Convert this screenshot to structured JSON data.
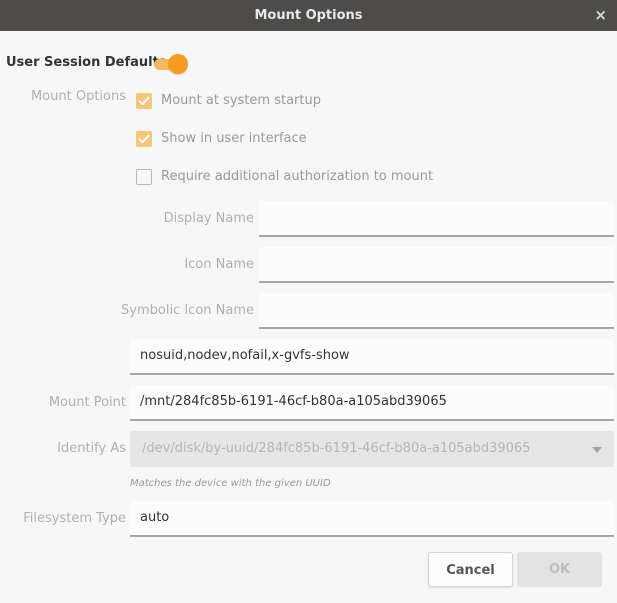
{
  "window": {
    "title": "Mount Options",
    "close_glyph": "×"
  },
  "section": {
    "title": "User Session Defaults",
    "toggle_on": true
  },
  "labels": {
    "mount_options": "Mount Options",
    "display_name": "Display Name",
    "icon_name": "Icon Name",
    "symbolic_icon_name": "Symbolic Icon Name",
    "mount_point": "Mount Point",
    "identify_as": "Identify As",
    "filesystem_type": "Filesystem Type"
  },
  "checkboxes": [
    {
      "label": "Mount at system startup",
      "checked": true
    },
    {
      "label": "Show in user interface",
      "checked": true
    },
    {
      "label": "Require additional authorization to mount",
      "checked": false
    }
  ],
  "fields": {
    "display_name": "",
    "icon_name": "",
    "symbolic_icon_name": "",
    "options": "nosuid,nodev,nofail,x-gvfs-show",
    "mount_point": "/mnt/284fc85b-6191-46cf-b80a-a105abd39065",
    "identify_as": "/dev/disk/by-uuid/284fc85b-6191-46cf-b80a-a105abd39065",
    "identify_hint": "Matches the device with the given UUID",
    "filesystem_type": "auto"
  },
  "buttons": {
    "cancel": "Cancel",
    "ok": "OK"
  },
  "colors": {
    "accent": "#f79b20",
    "titlebar": "#4d4c4a"
  }
}
